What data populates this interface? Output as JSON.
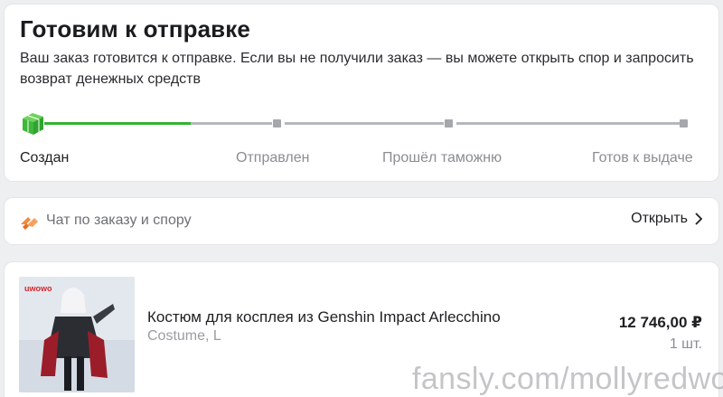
{
  "status": {
    "title": "Готовим к отправке",
    "description": "Ваш заказ готовится к отправке. Если вы не получили заказ — вы можете открыть спор и запросить возврат денежных средств",
    "steps": [
      "Создан",
      "Отправлен",
      "Прошёл таможню",
      "Готов к выдаче"
    ],
    "current_step": 1,
    "progress_fraction": 0.12,
    "accent_color": "#34b233",
    "icons": {
      "current_step": "box-icon"
    }
  },
  "chat": {
    "label": "Чат по заказу и спору",
    "open_label": "Открыть",
    "icons": {
      "chat": "order-chat-icon",
      "open": "chevron-right-icon"
    }
  },
  "product": {
    "name": "Костюм для косплея из Genshin Impact Arlecchino",
    "variant": "Costume, L",
    "price": "12 746,00 ₽",
    "quantity": "1 шт.",
    "thumbnail_logo": "uwowo"
  },
  "watermark": "fansly.com/mollyredwolf"
}
